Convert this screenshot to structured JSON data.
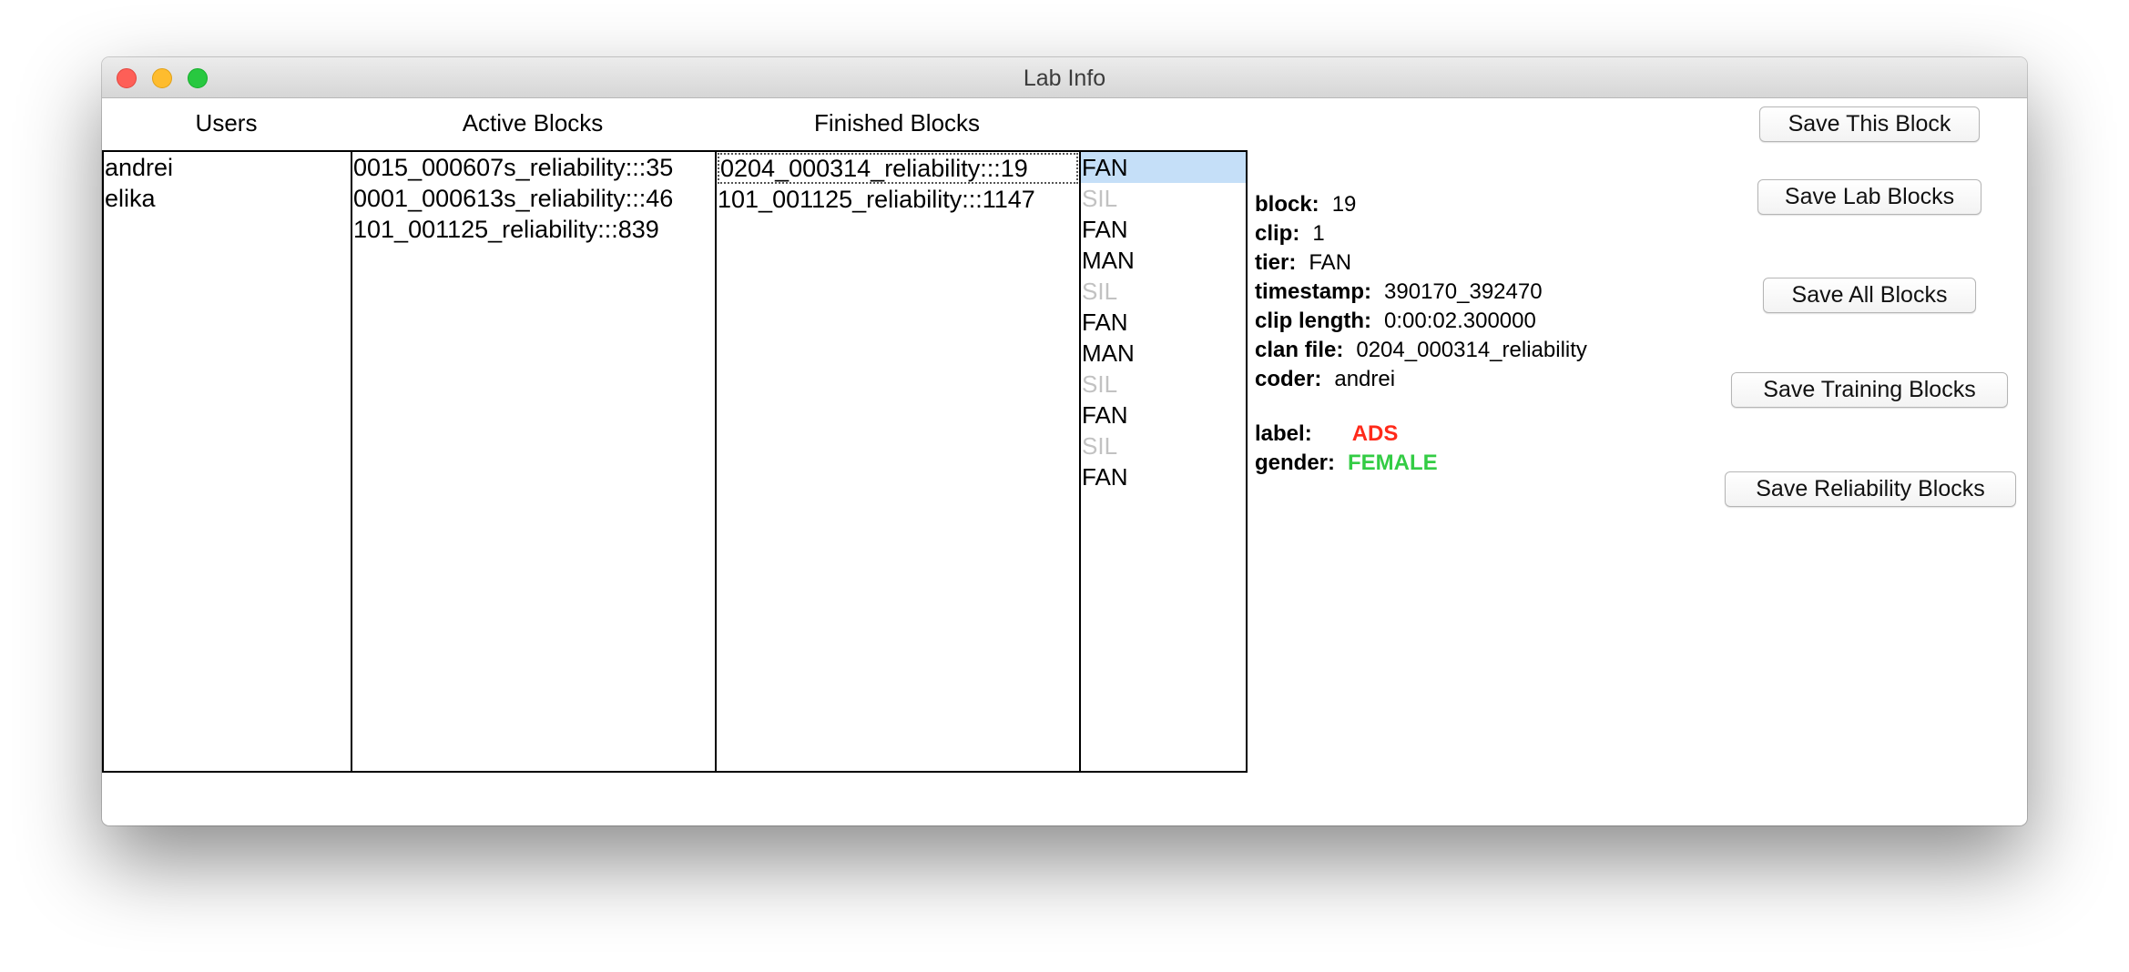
{
  "window": {
    "title": "Lab Info"
  },
  "columns": {
    "users": "Users",
    "active": "Active Blocks",
    "finished": "Finished Blocks"
  },
  "users": [
    "andrei",
    "elika"
  ],
  "active_blocks": [
    "0015_000607s_reliability:::35",
    "0001_000613s_reliability:::46",
    "101_001125_reliability:::839"
  ],
  "finished_blocks": [
    "0204_000314_reliability:::19",
    "101_001125_reliability:::1147"
  ],
  "tiers": [
    {
      "label": "FAN",
      "dim": false
    },
    {
      "label": "SIL",
      "dim": true
    },
    {
      "label": "FAN",
      "dim": false
    },
    {
      "label": "MAN",
      "dim": false
    },
    {
      "label": "SIL",
      "dim": true
    },
    {
      "label": "FAN",
      "dim": false
    },
    {
      "label": "MAN",
      "dim": false
    },
    {
      "label": "SIL",
      "dim": true
    },
    {
      "label": "FAN",
      "dim": false
    },
    {
      "label": "SIL",
      "dim": true
    },
    {
      "label": "FAN",
      "dim": false
    }
  ],
  "selected_tier_index": 0,
  "info": {
    "block_k": "block:",
    "block_v": "19",
    "clip_k": "clip:",
    "clip_v": "1",
    "tier_k": "tier:",
    "tier_v": "FAN",
    "timestamp_k": "timestamp:",
    "timestamp_v": "390170_392470",
    "cliplen_k": "clip length:",
    "cliplen_v": "0:00:02.300000",
    "clanfile_k": "clan file:",
    "clanfile_v": "0204_000314_reliability",
    "coder_k": "coder:",
    "coder_v": "andrei",
    "label_k": "label:",
    "label_v": "ADS",
    "gender_k": "gender:",
    "gender_v": "FEMALE"
  },
  "colors": {
    "label_value": "#ff2a1a",
    "gender_value": "#33cc44",
    "dim_tier": "#c2c2c2",
    "selection": "#c5dff8"
  },
  "buttons": {
    "save_this": "Save This Block",
    "save_lab": "Save Lab Blocks",
    "save_all": "Save All Blocks",
    "save_training": "Save Training Blocks",
    "save_reliability": "Save Reliability Blocks"
  }
}
